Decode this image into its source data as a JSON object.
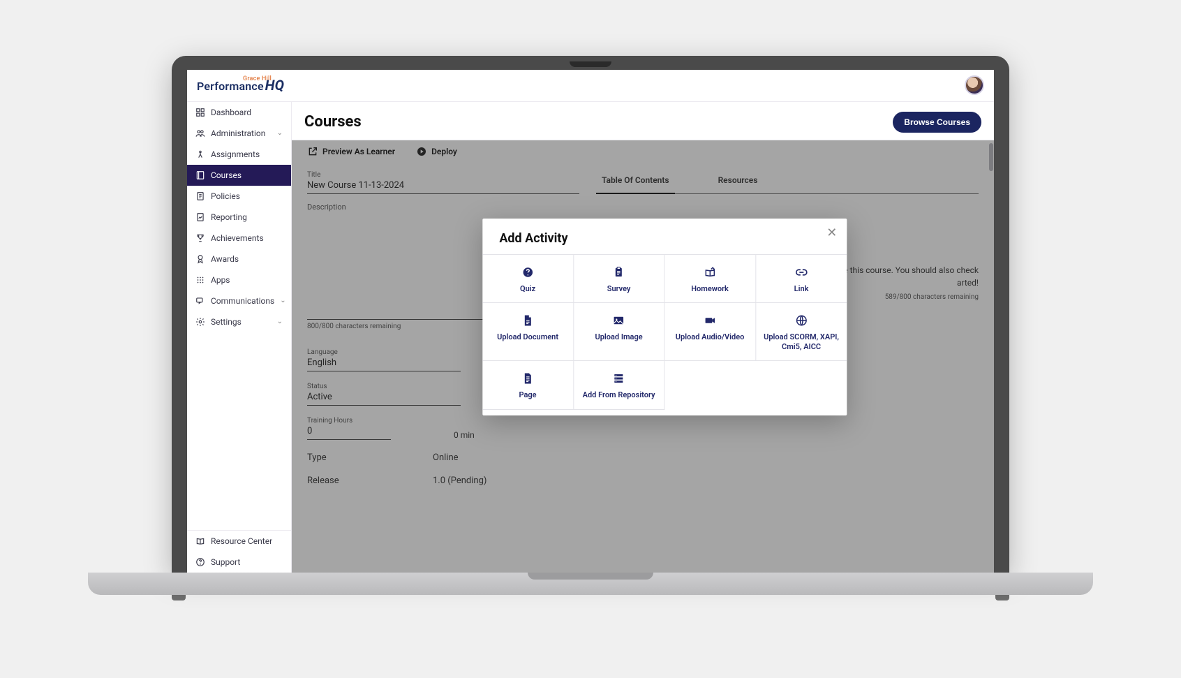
{
  "brand": {
    "main": "Performance",
    "small": "Grace Hill",
    "suffix": "HQ"
  },
  "sidebar": {
    "items": [
      {
        "id": "dashboard",
        "label": "Dashboard"
      },
      {
        "id": "administration",
        "label": "Administration",
        "expandable": true
      },
      {
        "id": "assignments",
        "label": "Assignments"
      },
      {
        "id": "courses",
        "label": "Courses",
        "active": true
      },
      {
        "id": "policies",
        "label": "Policies"
      },
      {
        "id": "reporting",
        "label": "Reporting"
      },
      {
        "id": "achievements",
        "label": "Achievements"
      },
      {
        "id": "awards",
        "label": "Awards"
      },
      {
        "id": "apps",
        "label": "Apps"
      },
      {
        "id": "communications",
        "label": "Communications",
        "expandable": true
      },
      {
        "id": "settings",
        "label": "Settings",
        "expandable": true
      }
    ],
    "footer": [
      {
        "id": "resource-center",
        "label": "Resource Center"
      },
      {
        "id": "support",
        "label": "Support"
      }
    ]
  },
  "page": {
    "title": "Courses",
    "browse_button": "Browse Courses"
  },
  "toolbar": {
    "preview": "Preview As Learner",
    "deploy": "Deploy"
  },
  "form": {
    "title_label": "Title",
    "title_value": "New Course 11-13-2024",
    "description_label": "Description",
    "desc_remaining": "800/800 characters remaining",
    "language_label": "Language",
    "language_value": "English",
    "status_label": "Status",
    "status_value": "Active",
    "hours_label": "Training Hours",
    "hours_value": "0",
    "hours_unit": "0 min",
    "type_label": "Type",
    "type_value": "Online",
    "release_label": "Release",
    "release_value": "1.0 (Pending)"
  },
  "right_panel": {
    "tab1": "Table Of Contents",
    "tab2": "Resources",
    "toc_text_1": "te this course. You should also check",
    "toc_text_2": "arted!",
    "toc_remaining": "589/800 characters remaining",
    "add_activity": "Add Activity"
  },
  "modal": {
    "title": "Add Activity",
    "items": [
      {
        "id": "quiz",
        "label": "Quiz"
      },
      {
        "id": "survey",
        "label": "Survey"
      },
      {
        "id": "homework",
        "label": "Homework"
      },
      {
        "id": "link",
        "label": "Link"
      },
      {
        "id": "upload-document",
        "label": "Upload Document"
      },
      {
        "id": "upload-image",
        "label": "Upload Image"
      },
      {
        "id": "upload-av",
        "label": "Upload Audio/Video"
      },
      {
        "id": "upload-scorm",
        "label": "Upload SCORM, XAPI, Cmi5, AICC"
      },
      {
        "id": "page",
        "label": "Page"
      },
      {
        "id": "add-repo",
        "label": "Add From Repository"
      }
    ]
  }
}
